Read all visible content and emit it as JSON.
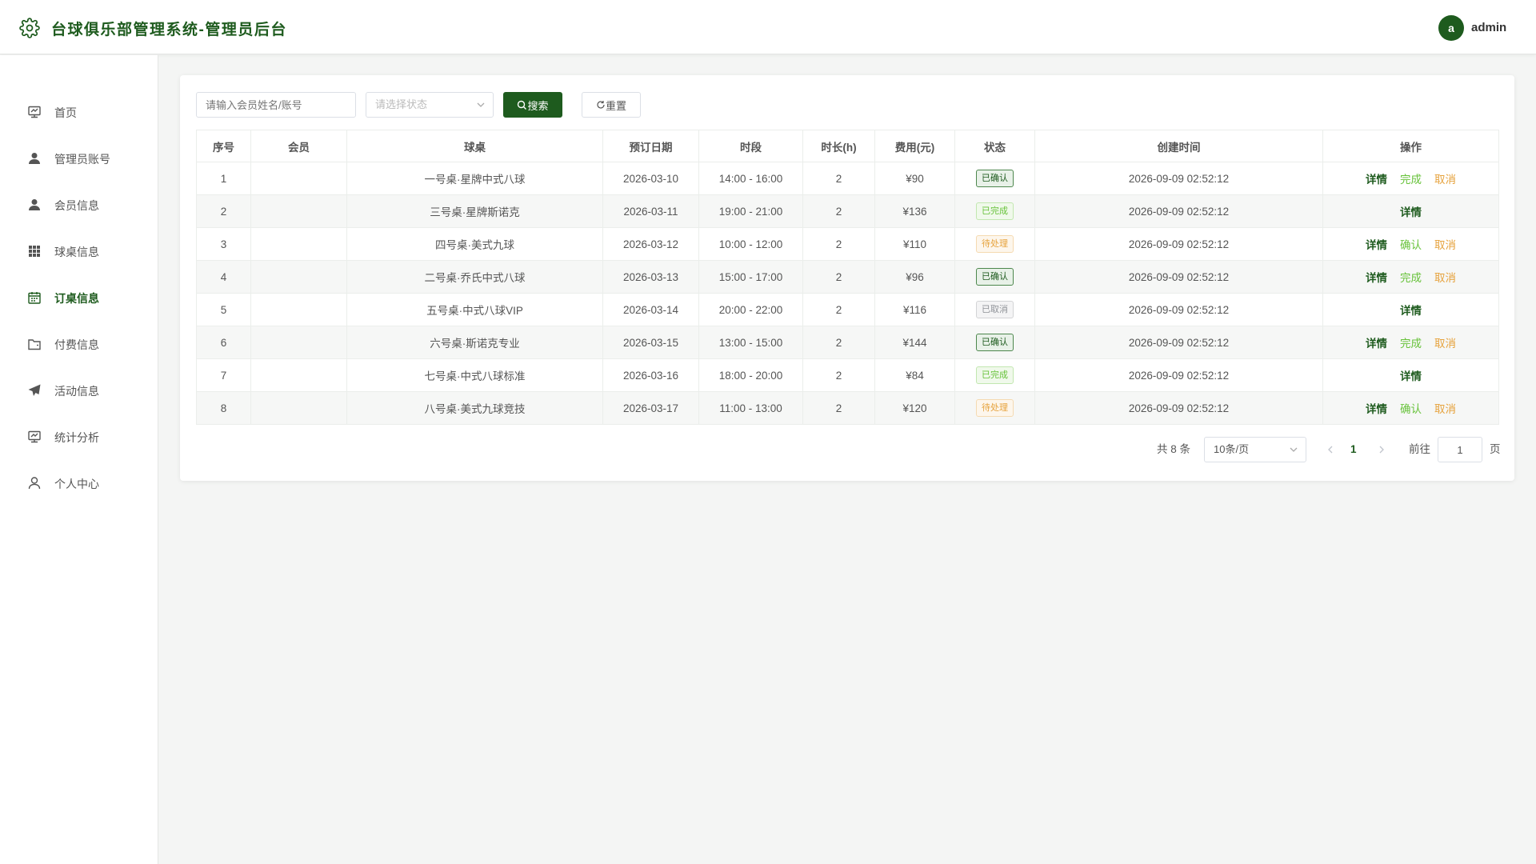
{
  "header": {
    "title": "台球俱乐部管理系统-管理员后台",
    "avatar_letter": "a",
    "username": "admin"
  },
  "sidebar": {
    "items": [
      {
        "label": "首页",
        "icon": "dashboard-icon"
      },
      {
        "label": "管理员账号",
        "icon": "user-icon"
      },
      {
        "label": "会员信息",
        "icon": "member-icon"
      },
      {
        "label": "球桌信息",
        "icon": "grid-icon"
      },
      {
        "label": "订桌信息",
        "icon": "calendar-icon",
        "active": true
      },
      {
        "label": "付费信息",
        "icon": "wallet-icon"
      },
      {
        "label": "活动信息",
        "icon": "send-icon"
      },
      {
        "label": "统计分析",
        "icon": "chart-icon"
      },
      {
        "label": "个人中心",
        "icon": "person-icon"
      }
    ]
  },
  "filters": {
    "search_placeholder": "请输入会员姓名/账号",
    "status_placeholder": "请选择状态",
    "search_button": "搜索",
    "reset_button": "重置"
  },
  "table": {
    "columns": [
      "序号",
      "会员",
      "球桌",
      "预订日期",
      "时段",
      "时长(h)",
      "费用(元)",
      "状态",
      "创建时间",
      "操作"
    ],
    "rows": [
      {
        "no": "1",
        "member": "",
        "table": "一号桌·星牌中式八球",
        "date": "2026-03-10",
        "slot": "14:00 - 16:00",
        "hours": "2",
        "fee": "¥90",
        "status": "已确认",
        "status_type": "confirmed",
        "created": "2026-09-09 02:52:12",
        "actions": [
          "详情",
          "完成",
          "取消"
        ]
      },
      {
        "no": "2",
        "member": "",
        "table": "三号桌·星牌斯诺克",
        "date": "2026-03-11",
        "slot": "19:00 - 21:00",
        "hours": "2",
        "fee": "¥136",
        "status": "已完成",
        "status_type": "done",
        "created": "2026-09-09 02:52:12",
        "actions": [
          "详情"
        ]
      },
      {
        "no": "3",
        "member": "",
        "table": "四号桌·美式九球",
        "date": "2026-03-12",
        "slot": "10:00 - 12:00",
        "hours": "2",
        "fee": "¥110",
        "status": "待处理",
        "status_type": "pending",
        "created": "2026-09-09 02:52:12",
        "actions": [
          "详情",
          "确认",
          "取消"
        ]
      },
      {
        "no": "4",
        "member": "",
        "table": "二号桌·乔氏中式八球",
        "date": "2026-03-13",
        "slot": "15:00 - 17:00",
        "hours": "2",
        "fee": "¥96",
        "status": "已确认",
        "status_type": "confirmed",
        "created": "2026-09-09 02:52:12",
        "actions": [
          "详情",
          "完成",
          "取消"
        ]
      },
      {
        "no": "5",
        "member": "",
        "table": "五号桌·中式八球VIP",
        "date": "2026-03-14",
        "slot": "20:00 - 22:00",
        "hours": "2",
        "fee": "¥116",
        "status": "已取消",
        "status_type": "cancelled",
        "created": "2026-09-09 02:52:12",
        "actions": [
          "详情"
        ]
      },
      {
        "no": "6",
        "member": "",
        "table": "六号桌·斯诺克专业",
        "date": "2026-03-15",
        "slot": "13:00 - 15:00",
        "hours": "2",
        "fee": "¥144",
        "status": "已确认",
        "status_type": "confirmed",
        "created": "2026-09-09 02:52:12",
        "actions": [
          "详情",
          "完成",
          "取消"
        ]
      },
      {
        "no": "7",
        "member": "",
        "table": "七号桌·中式八球标准",
        "date": "2026-03-16",
        "slot": "18:00 - 20:00",
        "hours": "2",
        "fee": "¥84",
        "status": "已完成",
        "status_type": "done",
        "created": "2026-09-09 02:52:12",
        "actions": [
          "详情"
        ]
      },
      {
        "no": "8",
        "member": "",
        "table": "八号桌·美式九球竞技",
        "date": "2026-03-17",
        "slot": "11:00 - 13:00",
        "hours": "2",
        "fee": "¥120",
        "status": "待处理",
        "status_type": "pending",
        "created": "2026-09-09 02:52:12",
        "actions": [
          "详情",
          "确认",
          "取消"
        ]
      }
    ]
  },
  "pagination": {
    "total_text": "共 8 条",
    "page_size": "10条/页",
    "current_page": "1",
    "goto_label": "前往",
    "goto_value": "1",
    "page_suffix": "页"
  },
  "colors": {
    "brand": "#1e5b1e",
    "success": "#67c23a",
    "warning": "#e6a23c",
    "muted": "#909399"
  }
}
